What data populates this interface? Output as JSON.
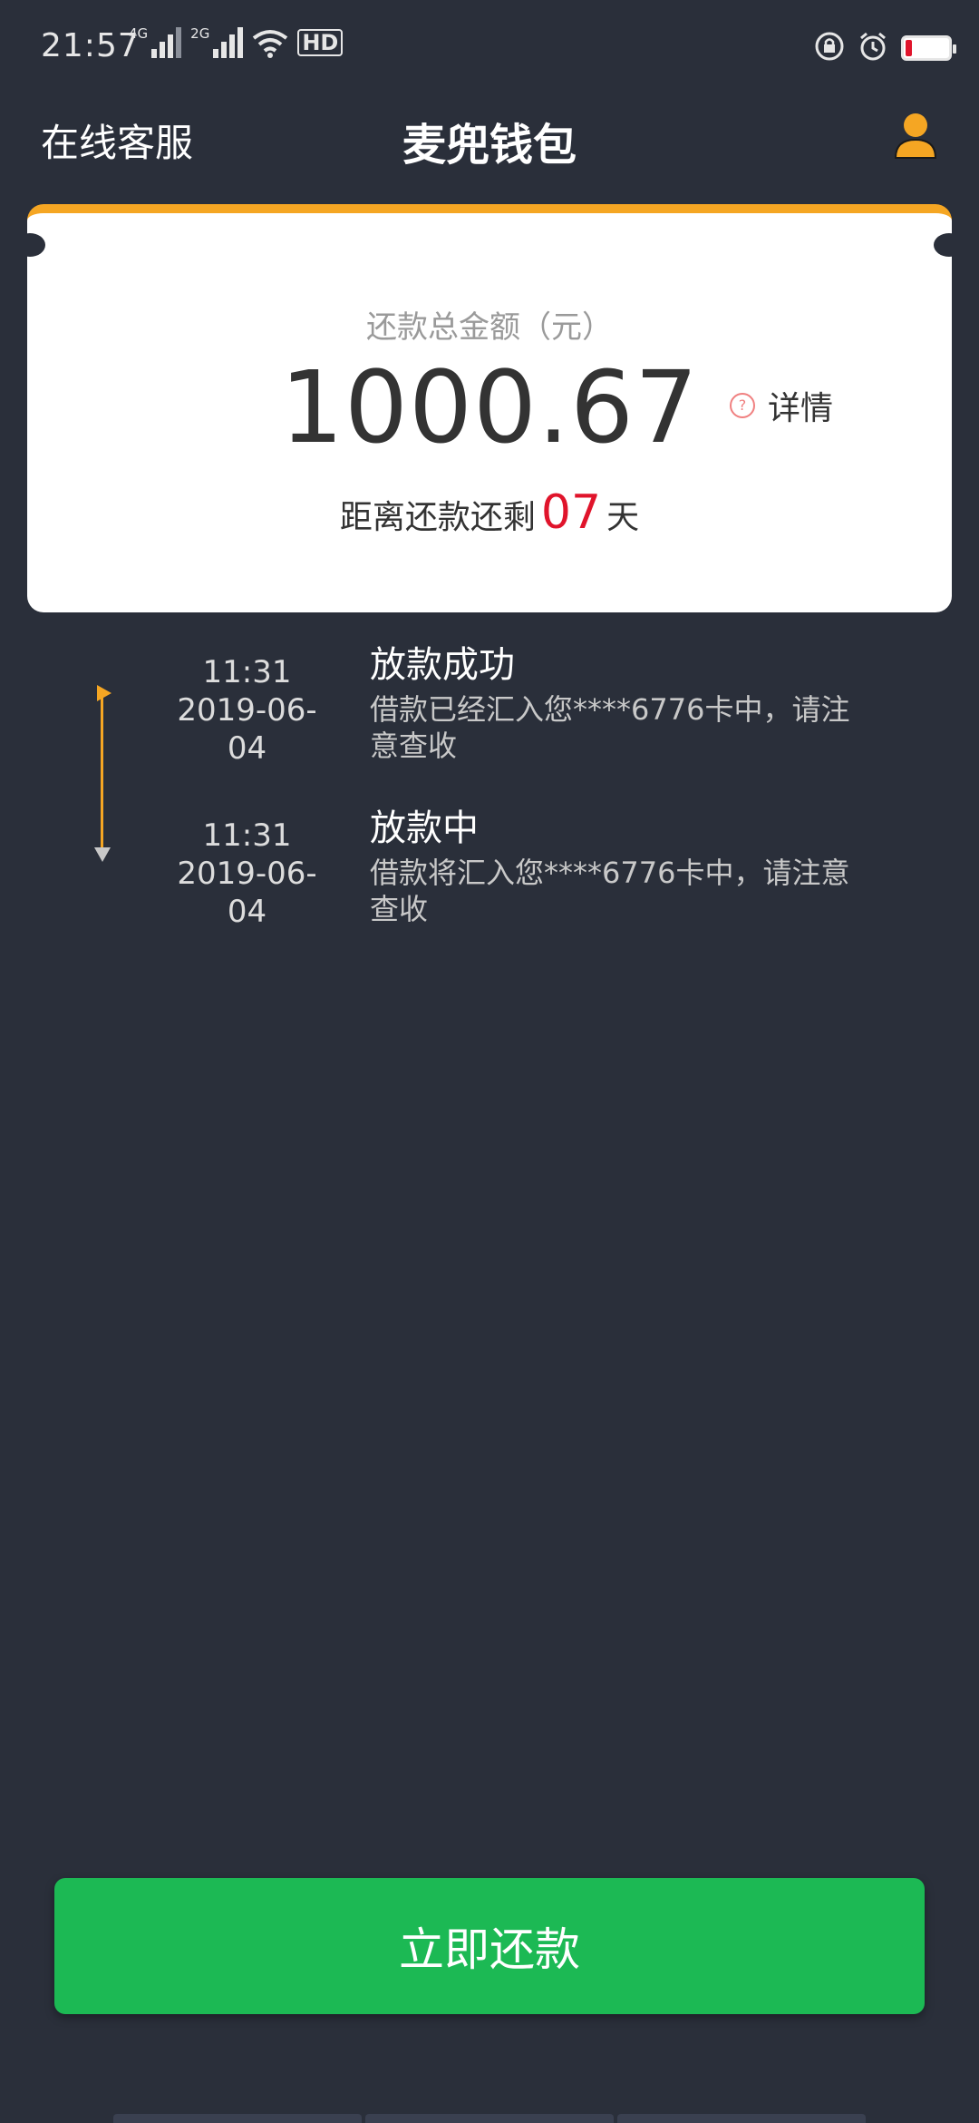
{
  "status_bar": {
    "time": "21:57",
    "network_1": "4G",
    "network_2": "2G",
    "hd_label": "HD",
    "icons": [
      "signal-icon",
      "wifi-icon",
      "hd-icon",
      "lock-rotation-icon",
      "alarm-icon",
      "battery-icon"
    ],
    "battery_level": 0.15
  },
  "header": {
    "service_label": "在线客服",
    "title": "麦兜钱包",
    "user_icon": "user-icon"
  },
  "card": {
    "label": "还款总金额（元）",
    "amount": "1000.67",
    "detail_label": "详情",
    "detail_icon_glyph": "?",
    "remaining_prefix": "距离还款还剩",
    "remaining_days": "07",
    "remaining_suffix": "天",
    "accent_color": "#f5a623",
    "days_color": "#e0142b"
  },
  "timeline": {
    "items": [
      {
        "time": "11:31",
        "date": "2019-06-04",
        "status": "放款成功",
        "description": "借款已经汇入您****6776卡中，请注意查收"
      },
      {
        "time": "11:31",
        "date": "2019-06-04",
        "status": "放款中",
        "description": "借款将汇入您****6776卡中，请注意查收"
      }
    ]
  },
  "actions": {
    "pay_label": "立即还款",
    "pay_color": "#1cb954"
  },
  "theme": {
    "background": "#2a2f3a"
  }
}
